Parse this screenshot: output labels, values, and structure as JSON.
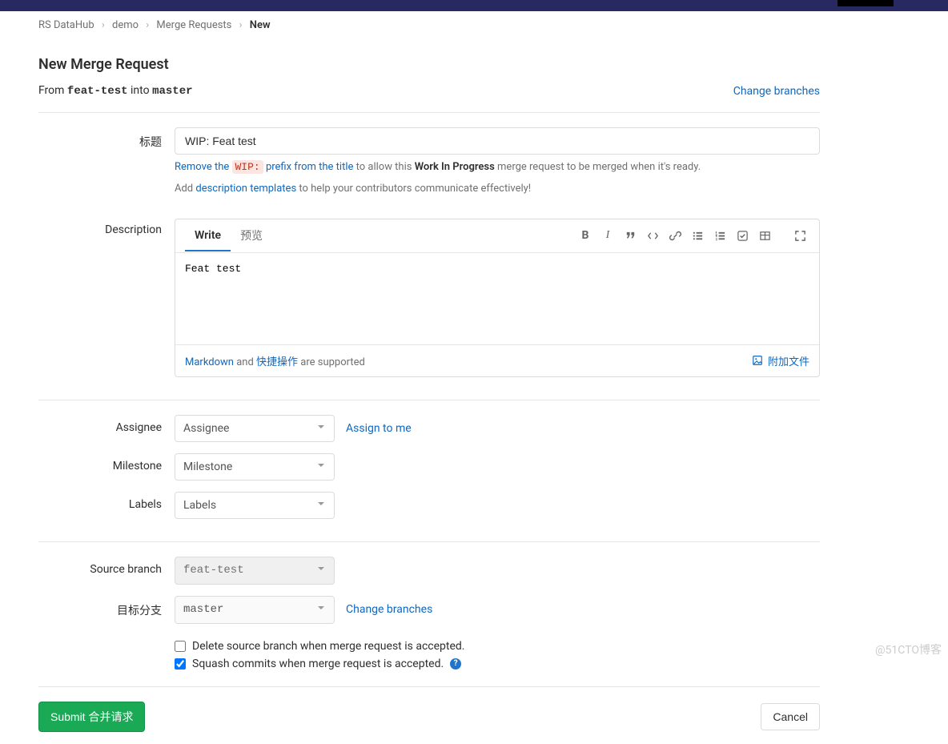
{
  "breadcrumb": {
    "items": [
      "RS DataHub",
      "demo",
      "Merge Requests"
    ],
    "current": "New"
  },
  "page": {
    "title": "New Merge Request",
    "from_label": "From",
    "source_branch": "feat-test",
    "into_label": "into",
    "target_branch": "master",
    "change_branches": "Change branches"
  },
  "form": {
    "title_label": "标题",
    "title_value": "WIP: Feat test",
    "wip_hint_prefix": "Remove the ",
    "wip_code": "WIP:",
    "wip_hint_mid": " prefix from the title",
    "wip_hint_tail1": " to allow this ",
    "wip_strong": "Work In Progress",
    "wip_hint_tail2": " merge request to be merged when it's ready.",
    "templates_pre": "Add ",
    "templates_link": "description templates",
    "templates_post": " to help your contributors communicate effectively!",
    "description_label": "Description",
    "tabs": {
      "write": "Write",
      "preview": "预览"
    },
    "description_value": "Feat test",
    "footer": {
      "markdown_link": "Markdown",
      "and": " and ",
      "shortcut_link": "快捷操作",
      "suffix": " are supported",
      "attach": "附加文件"
    },
    "assignee_label": "Assignee",
    "assignee_placeholder": "Assignee",
    "assign_to_me": "Assign to me",
    "milestone_label": "Milestone",
    "milestone_placeholder": "Milestone",
    "labels_label": "Labels",
    "labels_placeholder": "Labels",
    "source_branch_label": "Source branch",
    "source_branch_value": "feat-test",
    "target_branch_label": "目标分支",
    "target_branch_value": "master",
    "change_branches2": "Change branches",
    "delete_source": "Delete source branch when merge request is accepted.",
    "squash": "Squash commits when merge request is accepted.",
    "delete_checked": false,
    "squash_checked": true
  },
  "actions": {
    "submit": "Submit 合并请求",
    "cancel": "Cancel"
  },
  "watermark": "@51CTO博客"
}
